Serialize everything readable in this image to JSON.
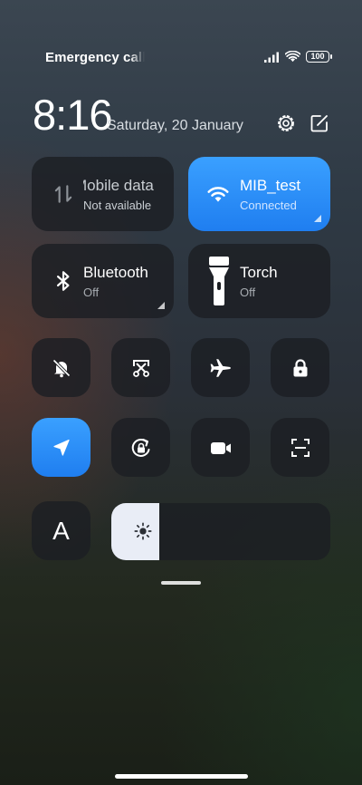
{
  "status_bar": {
    "carrier": "Emergency calls",
    "battery": "100"
  },
  "clock": {
    "time": "8:16",
    "date": "Saturday, 20 January"
  },
  "tiles": {
    "mobile_data": {
      "title": "Mobile data",
      "subtitle": "Not available",
      "active": false
    },
    "wifi": {
      "title": "MIB_test",
      "subtitle": "Connected",
      "active": true
    },
    "bluetooth": {
      "title": "Bluetooth",
      "subtitle": "Off",
      "active": false
    },
    "torch": {
      "title": "Torch",
      "subtitle": "Off",
      "active": false
    }
  },
  "toggles": {
    "row1": [
      "bell-off-icon",
      "screenshot-crop-icon",
      "airplane-icon",
      "lock-icon"
    ],
    "row2": [
      "location-arrow-icon",
      "rotation-lock-icon",
      "video-camera-icon",
      "scan-icon"
    ]
  },
  "font_size_label": "A",
  "brightness": {
    "level": 0.22
  },
  "colors": {
    "accent": "#2a8cf7"
  }
}
